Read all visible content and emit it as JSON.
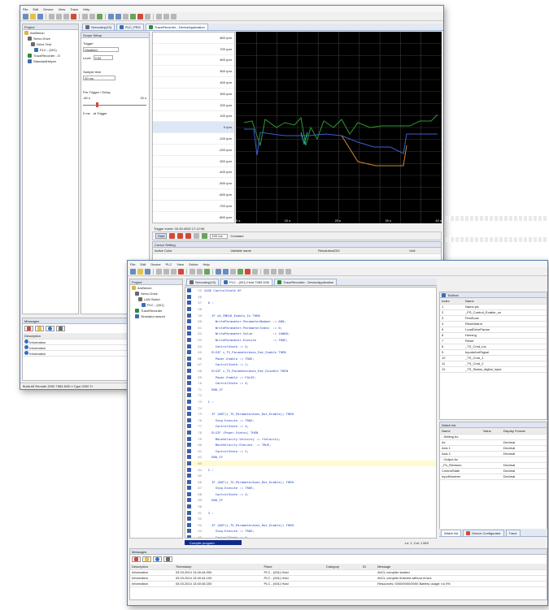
{
  "window1": {
    "menu": [
      "File",
      "Edit",
      "Device",
      "View",
      "Trace",
      "Help"
    ],
    "tabs": [
      "Servostep(10)",
      "PLC_PRG",
      "TraceRecorder - DeviceApplication"
    ],
    "project_tree": [
      "Project",
      "ArnBench",
      "Servo Drive",
      "Drive-Test",
      "PLC - (001)",
      "TraceRecorder - D",
      "StandardHelper"
    ],
    "settings_title": "Scope Setup",
    "trigger_label": "Trigger",
    "trigger_value": "Disabled",
    "level_label": "Level",
    "level_value": "0.00",
    "sample_label": "Sample time",
    "sample_value": "20 ms",
    "pretrigger_label": "Pre-Trigger / Delay",
    "pre_left": "-60 s",
    "pre_right": "20 s",
    "mode_left": "0 ms",
    "mode_right": "at Trigger",
    "y_axis_values": [
      "800 rpm",
      "700 rpm",
      "600 rpm",
      "500 rpm",
      "400 rpm",
      "300 rpm",
      "200 rpm",
      "100 rpm",
      "0 rpm",
      "-100 rpm",
      "-200 rpm",
      "-300 rpm",
      "-400 rpm",
      "-500 rpm",
      "-600 rpm",
      "-700 rpm",
      "-800 rpm"
    ],
    "x_axis_values": [
      "0 s",
      "10 s",
      "20 s",
      "30 s",
      "40 s"
    ],
    "trigger_status": "Trigger event: 00.00.0000 17:12:06",
    "run_button": "Start",
    "scope_channel": "100 ms",
    "scope_mode": "Constant",
    "cursor_title": "Cursor Setting",
    "cursor_cols": [
      "Active Color",
      "Variable name",
      "Resolution/DIV",
      "Unit"
    ],
    "message_header": "Messages",
    "message_cols": [
      "Description",
      "Timestamp",
      "Place"
    ],
    "messages": [
      [
        "Information",
        "03.03.2014 13:40:44:000",
        "PLC - (001)"
      ],
      [
        "Information",
        "03.03.2014 13:40:44:100",
        "PLC - (001)"
      ],
      [
        "Information",
        "03.03.2014 13:40:45:200",
        "PLC - (001)"
      ]
    ],
    "status": "Build All   Remote 2000 7983-5/30 x  Type 2000 Tr"
  },
  "window2": {
    "menu": [
      "File",
      "Edit",
      "Device",
      "PLC",
      "View",
      "Online",
      "Help"
    ],
    "tabs": [
      "Servostep(10)",
      "PLC - (001) Hold 7983-5/30",
      "TraceRecorder - DeviceApplication"
    ],
    "project_tree": [
      "Project",
      "ArnBench",
      "Servo Drive",
      "LAN Swtch",
      "PLC - (001)",
      "TraceRecorder",
      "Simulator search"
    ],
    "code_lines": [
      {
        "n": "55",
        "t": "CASE ControlState OF"
      },
      {
        "n": "56",
        "t": ""
      },
      {
        "n": "57",
        "t": "  0 :"
      },
      {
        "n": "58",
        "t": ""
      },
      {
        "n": "59",
        "t": "    IF sA_CMD16_Enable_In THEN"
      },
      {
        "n": "60",
        "t": "      WriteParameter.ParameterNumber := 600;"
      },
      {
        "n": "61",
        "t": "      WriteParameter.ParameterIndex  := 0;"
      },
      {
        "n": "62",
        "t": "      WriteParameter.Value           := 16#80;"
      },
      {
        "n": "63",
        "t": "      WriteParameter.Execute         := TRUE;"
      },
      {
        "n": "64",
        "t": "      ControlState := 5;"
      },
      {
        "n": "65",
        "t": "    ELSIF i_TS_ParameterAxes_Rot_Enable THEN"
      },
      {
        "n": "66",
        "t": "      Power.Enable := TRUE;"
      },
      {
        "n": "67",
        "t": "      ControlState := 1;"
      },
      {
        "n": "68",
        "t": "    ELSIF i_TS_ParameterAxes_Rot_Disable THEN"
      },
      {
        "n": "69",
        "t": "      Power.Enable := FALSE;"
      },
      {
        "n": "70",
        "t": "      ControlState := 4;"
      },
      {
        "n": "71",
        "t": "    END_IF"
      },
      {
        "n": "72",
        "t": ""
      },
      {
        "n": "73",
        "t": "  1 :"
      },
      {
        "n": "74",
        "t": ""
      },
      {
        "n": "75",
        "t": "    IF (NOT(i_TS_ParameterAxes_Rot_Enable)) THEN"
      },
      {
        "n": "76",
        "t": "      Stop.Execute := TRUE;"
      },
      {
        "n": "77",
        "t": "      ControlState := 4;"
      },
      {
        "n": "78",
        "t": "    ELSIF (Power.Status) THEN"
      },
      {
        "n": "79",
        "t": "      MoveVelocity.Velocity := rVelocity;"
      },
      {
        "n": "80",
        "t": "      MoveVelocity.Execute  := TRUE;"
      },
      {
        "n": "81",
        "t": "      ControlState := 2;"
      },
      {
        "n": "82",
        "t": "    END_IF"
      },
      {
        "n": "83",
        "t": ""
      },
      {
        "n": "84",
        "t": "  2 :"
      },
      {
        "n": "85",
        "t": ""
      },
      {
        "n": "86",
        "t": "    IF (NOT(i_TS_ParameterAxes_Rot_Enable)) THEN"
      },
      {
        "n": "87",
        "t": "      Stop.Execute := TRUE;"
      },
      {
        "n": "88",
        "t": "      ControlState := 4;"
      },
      {
        "n": "89",
        "t": "    END_IF"
      },
      {
        "n": "90",
        "t": ""
      },
      {
        "n": "91",
        "t": "  3 :"
      },
      {
        "n": "92",
        "t": ""
      },
      {
        "n": "93",
        "t": "    IF (NOT(i_TS_ParameterAxes_Rot_Enable)) THEN"
      },
      {
        "n": "94",
        "t": "      Stop.Execute := TRUE;"
      },
      {
        "n": "95",
        "t": "      ControlState := 4;"
      },
      {
        "n": "96",
        "t": "    ELSIF (Power.Status) THEN"
      },
      {
        "n": "97",
        "t": "      MoveVelocity.Velocity := -rVelocity;"
      },
      {
        "n": "98",
        "t": "      MoveVelocity.Execute  := TRUE;"
      },
      {
        "n": "99",
        "t": "      ControlState := 2;"
      }
    ],
    "toolbox_title": "Toolbox",
    "toolbox_cols": [
      "Index",
      "Name"
    ],
    "toolbox_rows": [
      [
        "1",
        "Name.plc"
      ],
      [
        "2",
        "_PS_Control_Enable_on"
      ],
      [
        "3",
        "FirstScan"
      ],
      [
        "4",
        "ResetAlarm"
      ],
      [
        "5",
        "LoadDriveParam"
      ],
      [
        "6",
        "Homing"
      ],
      [
        "7",
        "Reset"
      ],
      [
        "8",
        "_TS_Cmd_Ios"
      ],
      [
        "9",
        "InputsAndSignal"
      ],
      [
        "10",
        "_TS_Cmd_1"
      ],
      [
        "11",
        "_TS_Cmd_2"
      ],
      [
        "12",
        "_TS_Status_digital_input"
      ]
    ],
    "watch_title": "Watch list",
    "watch_cols": [
      "Name",
      "Value",
      "Display Format"
    ],
    "watch_rows": [
      [
        "- Setting Ax",
        "",
        ""
      ],
      [
        "  Ax",
        "",
        "Decimal"
      ],
      [
        "  Axis 1",
        "",
        "Decimal"
      ],
      [
        "  Axis 2",
        "",
        "Decimal"
      ],
      [
        "- Output Ax",
        "",
        ""
      ],
      [
        "  _Fb_Revision",
        "",
        "Decimal"
      ],
      [
        "  ControlState",
        "",
        "Decimal"
      ],
      [
        "  InputNumber",
        "",
        "Decimal"
      ]
    ],
    "bottom_tabs": [
      "Watch list",
      "Device Configurator",
      "Trace"
    ],
    "progress_label": "Compile program",
    "line_info": "Ln: 1, Col: 1 INS",
    "message_header": "Messages",
    "message_cols": [
      "Description",
      "Timestamp",
      "Place",
      "Category",
      "ID",
      "Message"
    ],
    "messages": [
      [
        "Information",
        "03.03.2014 13:40:44:000",
        "PLC - (001) Hold",
        "",
        "",
        "AVCL compiler started"
      ],
      [
        "Information",
        "03.03.2014 13:40:44:100",
        "PLC - (001) Hold",
        "",
        "",
        "AVCL compiler finished without errors"
      ],
      [
        "Information",
        "03.03.2014 13:40:45:200",
        "PLC - (001) Hold",
        "",
        "",
        "Resources: 0000/0000/0000  Battery usage: no 0%"
      ]
    ]
  },
  "colors": {
    "accent": "#3b5ea8",
    "trace_green": "#2e9a2e",
    "trace_blue": "#3a5fd0",
    "trace_orange": "#d08a2a",
    "trace_cyan": "#36c0c0"
  }
}
